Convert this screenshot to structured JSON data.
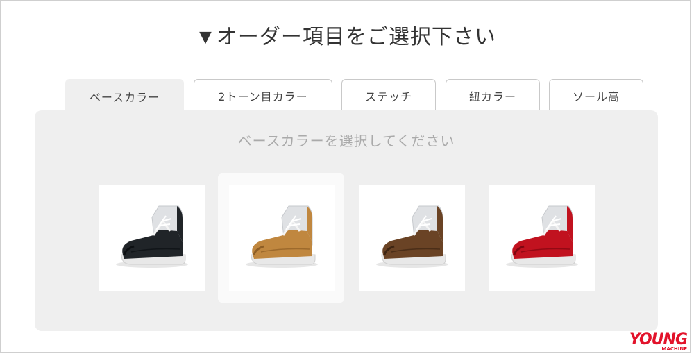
{
  "heading": "▼オーダー項目をご選択下さい",
  "tabs": [
    {
      "label": "ベースカラー",
      "active": true
    },
    {
      "label": "2トーン目カラー",
      "active": false
    },
    {
      "label": "ステッチ",
      "active": false
    },
    {
      "label": "紐カラー",
      "active": false
    },
    {
      "label": "ソール高",
      "active": false
    }
  ],
  "panel": {
    "prompt": "ベースカラーを選択してください",
    "options": [
      {
        "icon": "boot-black-icon",
        "color": "#202428",
        "dark": "#0c0f12",
        "selected": false
      },
      {
        "icon": "boot-tan-icon",
        "color": "#c0873f",
        "dark": "#8e5e25",
        "selected": true
      },
      {
        "icon": "boot-brown-icon",
        "color": "#6a4325",
        "dark": "#3e2512",
        "selected": false
      },
      {
        "icon": "boot-red-icon",
        "color": "#c1121f",
        "dark": "#7f0610",
        "selected": false
      }
    ]
  },
  "logo": {
    "main": "YOUNG",
    "sub": "MACHINE"
  }
}
